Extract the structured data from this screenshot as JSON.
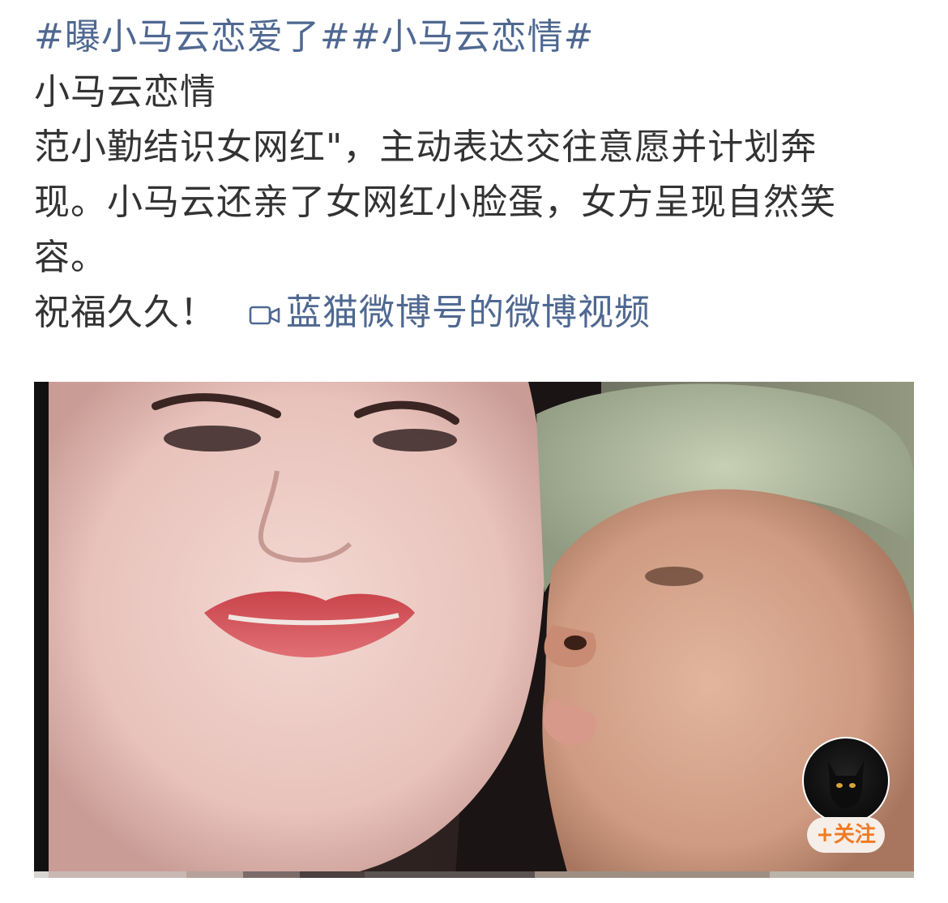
{
  "post": {
    "topics": [
      "#曝小马云恋爱了#",
      "#小马云恋情#"
    ],
    "line2": "小马云恋情",
    "line3": "范小勤结识女网红\"，主动表达交往意愿并计划奔",
    "line4": "现。小马云还亲了女网红小脸蛋，女方呈现自然笑",
    "line5": "容。",
    "line6": "祝福久久！",
    "video_link": {
      "icon": "video-camera-icon",
      "label": "蓝猫微博号的微博视频"
    }
  },
  "video": {
    "follow_label": "+关注",
    "avatar_icon": "black-cat-avatar"
  },
  "colors": {
    "link": "#4f6891",
    "text": "#333333",
    "follow_text": "#f07a25",
    "follow_bg": "#f6efe9"
  }
}
